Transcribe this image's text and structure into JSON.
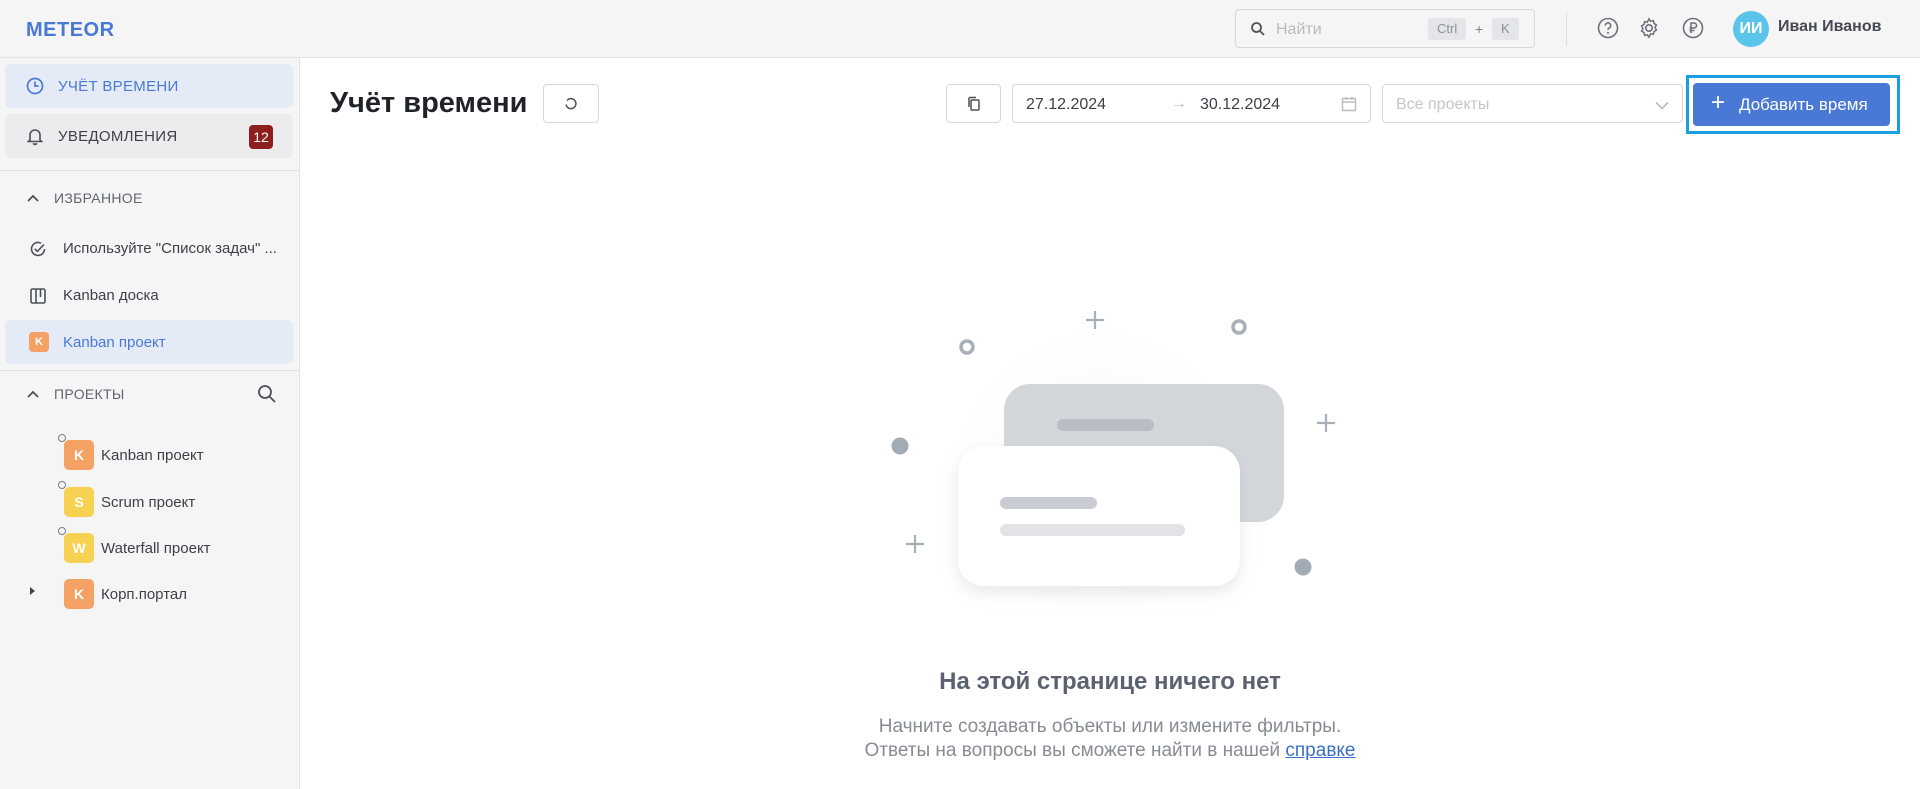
{
  "app": {
    "logo": "METEOR"
  },
  "search": {
    "placeholder": "Найти",
    "kbd_ctrl": "Ctrl",
    "kbd_plus": "+",
    "kbd_key": "K"
  },
  "user": {
    "initials": "ИИ",
    "name": "Иван Иванов",
    "avatar_color": "#5ac4ea"
  },
  "sidebar": {
    "nav": [
      {
        "label": "УЧЁТ ВРЕМЕНИ",
        "icon": "clock-icon",
        "active": true
      },
      {
        "label": "УВЕДОМЛЕНИЯ",
        "icon": "bell-icon",
        "badge": "12"
      }
    ],
    "favorites": {
      "header": "ИЗБРАННОЕ",
      "items": [
        {
          "label": "Используйте \"Список задач\" ...",
          "icon": "check-circle-icon"
        },
        {
          "label": "Kanban доска",
          "icon": "board-icon"
        },
        {
          "label": "Kanban проект",
          "icon_letter": "K",
          "active": true
        }
      ]
    },
    "projects": {
      "header": "ПРОЕКТЫ",
      "items": [
        {
          "label": "Kanban проект",
          "letter": "K",
          "color": "#f4a163"
        },
        {
          "label": "Scrum проект",
          "letter": "S",
          "color": "#f7d252"
        },
        {
          "label": "Waterfall проект",
          "letter": "W",
          "color": "#f7d252"
        },
        {
          "label": "Корп.портал",
          "letter": "K",
          "color": "#f4a163"
        }
      ]
    }
  },
  "main": {
    "title": "Учёт времени",
    "date_from": "27.12.2024",
    "date_sep": "→",
    "date_to": "30.12.2024",
    "project_filter_placeholder": "Все проекты",
    "add_button": {
      "plus": "+",
      "label": "Добавить время"
    },
    "empty": {
      "title": "На этой странице ничего нет",
      "line1": "Начните создавать объекты или измените фильтры.",
      "line2_prefix": "Ответы на вопросы вы сможете найти в нашей ",
      "line2_link": "справке"
    }
  },
  "colors": {
    "accent": "#4a78d6",
    "badge": "#8e1f1f",
    "highlight_outline": "#1a9fe0"
  }
}
